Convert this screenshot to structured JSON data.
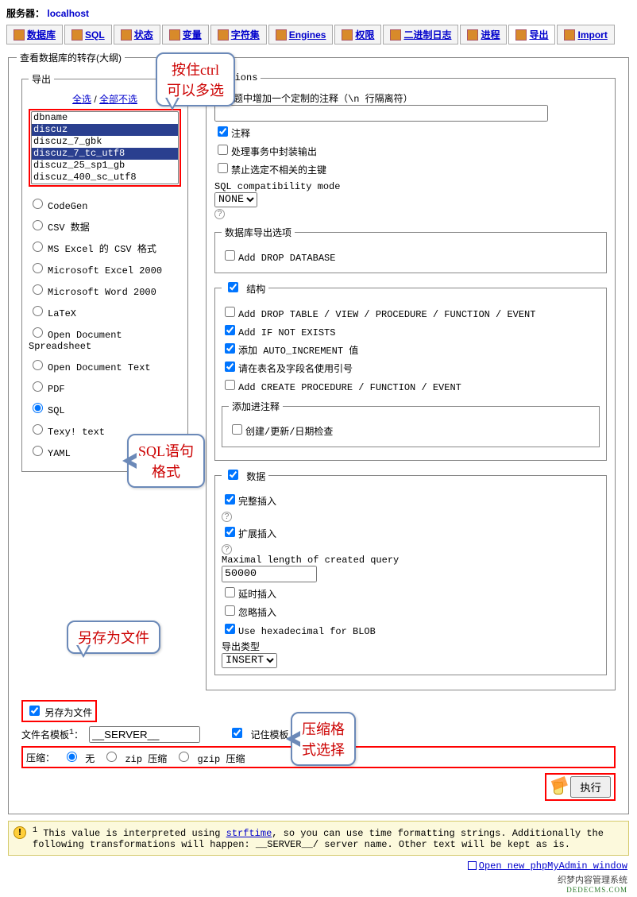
{
  "server": {
    "label": "服务器：",
    "host": "localhost"
  },
  "tabs": [
    "数据库",
    "SQL",
    "状态",
    "变量",
    "字符集",
    "Engines",
    "权限",
    "二进制日志",
    "进程",
    "导出",
    "Import"
  ],
  "active_tab_index": 9,
  "mainLegend": "查看数据库的转存(大纲)",
  "export": {
    "legend": "导出",
    "selectAll": "全选",
    "selectNone": "全部不选",
    "databases": [
      "dbname",
      "discuz",
      "discuz_7_gbk",
      "discuz_7_tc_utf8",
      "discuz_25_sp1_gb",
      "discuz_400_sc_utf8"
    ],
    "selected": [
      1,
      3
    ],
    "formats": [
      "CodeGen",
      "CSV 数据",
      "MS Excel 的 CSV 格式",
      "Microsoft Excel 2000",
      "Microsoft Word 2000",
      "LaTeX",
      "Open Document Spreadsheet",
      "Open Document Text",
      "PDF",
      "SQL",
      "Texy! text",
      "YAML"
    ],
    "formatSelected": "SQL"
  },
  "options": {
    "legend": "Options",
    "commentLabel": "在标题中增加一个定制的注释（\\n 行隔离符）",
    "commentValue": "",
    "comments": {
      "checked": true,
      "label": "注释"
    },
    "transaction": {
      "checked": false,
      "label": "处理事务中封装输出"
    },
    "disableFK": {
      "checked": false,
      "label": "禁止选定不相关的主键"
    },
    "sqlCompatLabel": "SQL compatibility mode",
    "sqlCompat": "NONE",
    "dbExport": {
      "legend": "数据库导出选项",
      "dropDb": {
        "checked": false,
        "label": "Add DROP DATABASE"
      }
    },
    "structure": {
      "enabled": true,
      "legend": "结构",
      "dropTable": {
        "checked": false,
        "label": "Add DROP TABLE / VIEW / PROCEDURE / FUNCTION / EVENT"
      },
      "ifNotExists": {
        "checked": true,
        "label": "Add IF NOT EXISTS"
      },
      "autoInc": {
        "checked": true,
        "label": "添加 AUTO_INCREMENT 值"
      },
      "backquotes": {
        "checked": true,
        "label": "请在表名及字段名使用引号"
      },
      "createProc": {
        "checked": false,
        "label": "Add CREATE PROCEDURE / FUNCTION / EVENT"
      },
      "addComments": {
        "legend": "添加进注释",
        "dates": {
          "checked": false,
          "label": "创建/更新/日期检查"
        }
      }
    },
    "data": {
      "enabled": true,
      "legend": "数据",
      "complete": {
        "checked": true,
        "label": "完整插入"
      },
      "extended": {
        "checked": true,
        "label": "扩展插入"
      },
      "maxLenLabel": "Maximal length of created query",
      "maxLen": "50000",
      "delayed": {
        "checked": false,
        "label": "延时插入"
      },
      "ignore": {
        "checked": false,
        "label": "忽略插入"
      },
      "hexBlob": {
        "checked": true,
        "label": "Use hexadecimal for BLOB"
      },
      "exportTypeLabel": "导出类型",
      "exportType": "INSERT"
    }
  },
  "saveFile": {
    "checked": true,
    "label": "另存为文件"
  },
  "template": {
    "label": "文件名模板",
    "sup": "1",
    "value": "__SERVER__",
    "remember": {
      "checked": true,
      "label": "记住模板"
    }
  },
  "compression": {
    "label": "压缩：",
    "none": "无",
    "zip": "zip 压缩",
    "gzip": "gzip 压缩",
    "selected": "none"
  },
  "execute": "执行",
  "note": {
    "pre": "This value is interpreted using ",
    "strftime": "strftime",
    "post": ", so you can use time formatting strings. Additionally the following transformations will happen: __SERVER__/ server name. Other text will be kept as is."
  },
  "footer": {
    "link": "Open new phpMyAdmin window"
  },
  "brand": {
    "line1": "织梦内容管理系统",
    "line2": "DEDECMS.COM"
  },
  "callouts": {
    "ctrl": "按住ctrl\n可以多选",
    "sqlFmt": "SQL语句\n格式",
    "saveAs": "另存为文件",
    "compress": "压缩格\n式选择"
  }
}
